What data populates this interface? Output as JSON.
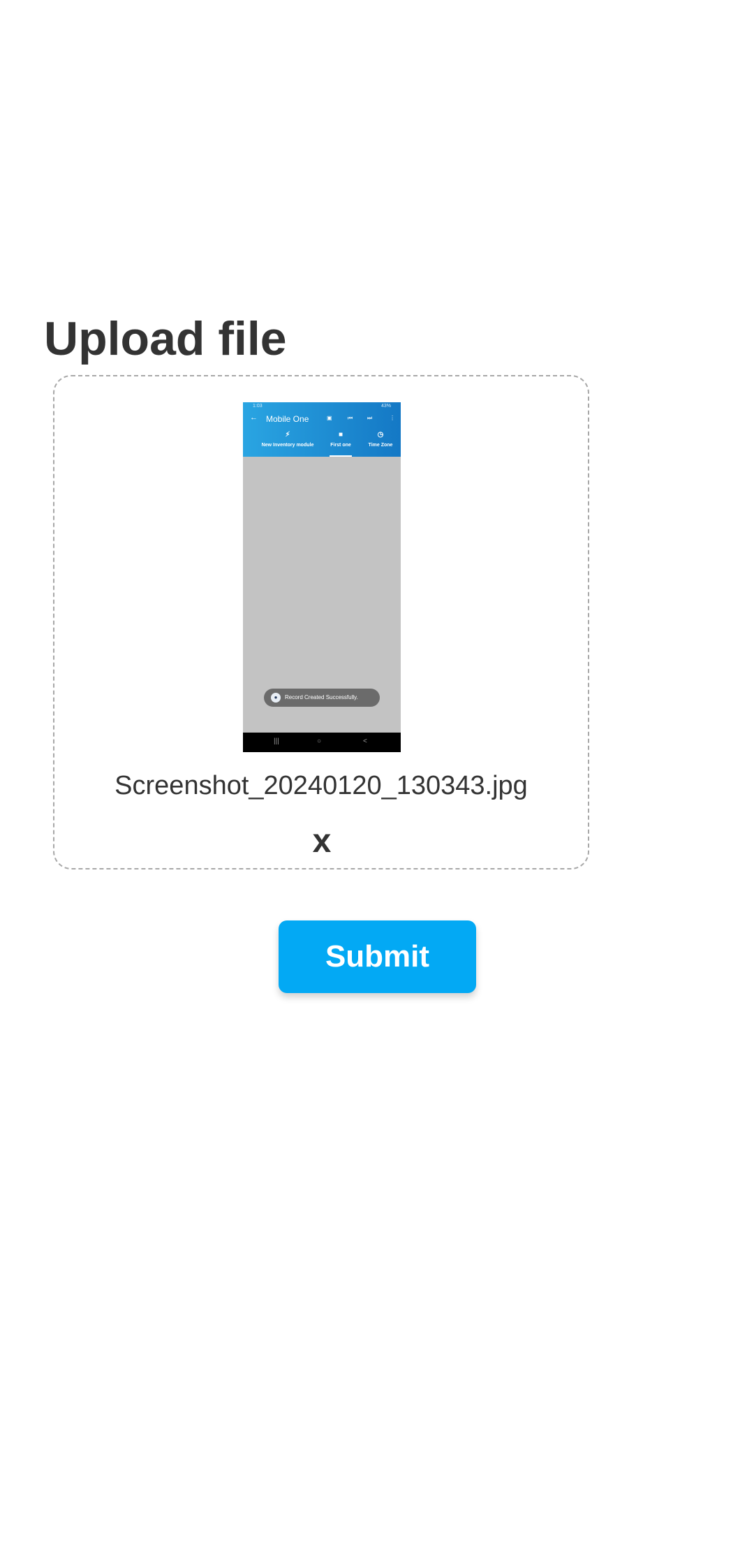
{
  "title": "Upload file",
  "preview": {
    "status": {
      "time": "1:03",
      "battery": "43%"
    },
    "app_title": "Mobile One",
    "tabs": [
      {
        "label": "New Inventory module",
        "icon": "bolt-icon"
      },
      {
        "label": "First one",
        "icon": "folder-icon",
        "selected": true
      },
      {
        "label": "Time Zone",
        "icon": "clock-icon"
      }
    ],
    "toast": "Record Created Successfully."
  },
  "file_name": "Screenshot_20240120_130343.jpg",
  "remove_label": "x",
  "submit_label": "Submit",
  "colors": {
    "accent": "#03a9f4",
    "text": "#333333",
    "dropzone_border": "#a8a8a8"
  }
}
